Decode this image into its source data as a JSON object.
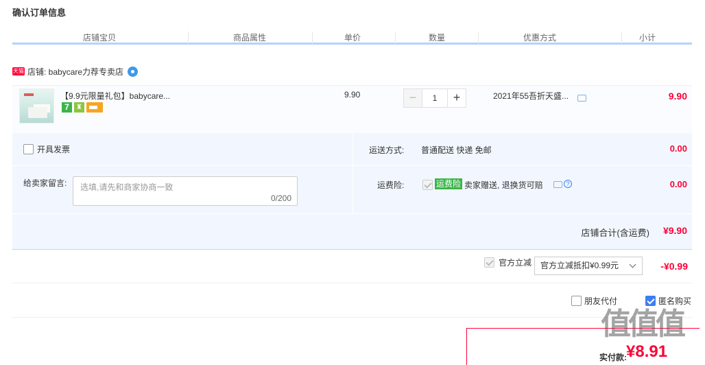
{
  "page_title": "确认订单信息",
  "columns": [
    "店铺宝贝",
    "商品属性",
    "单价",
    "数量",
    "优惠方式",
    "小计"
  ],
  "shop": {
    "badge": "天猫",
    "name": "店铺: babycare力荐专卖店"
  },
  "item": {
    "title": "【9.9元限量礼包】babycare...",
    "service_badge": "7",
    "unit_price": "9.90",
    "quantity": "1",
    "qty_minus": "−",
    "qty_plus": "+",
    "discount": "2021年55吾折天盛...",
    "subtotal": "9.90"
  },
  "invoice_label": "开具发票",
  "shipping": {
    "label": "运送方式:",
    "value": "普通配送 快递 免邮",
    "price": "0.00"
  },
  "memo": {
    "label": "给卖家留言:",
    "placeholder": "选填,请先和商家协商一致",
    "count": "0/200"
  },
  "insurance": {
    "label": "运费险:",
    "tag": "运费险",
    "text": "卖家赠送, 退换货可赔",
    "help": "?",
    "price": "0.00"
  },
  "shop_total": {
    "label": "店铺合计(含运费)",
    "value": "¥9.90"
  },
  "official_discount": {
    "label": "官方立减",
    "selected": "官方立减抵扣¥0.99元",
    "amount": "-¥0.99"
  },
  "friend_pay_label": "朋友代付",
  "anonymous_label": "匿名购买",
  "payment": {
    "label": "实付款:",
    "amount": "¥8.91"
  },
  "watermark": "值值值"
}
